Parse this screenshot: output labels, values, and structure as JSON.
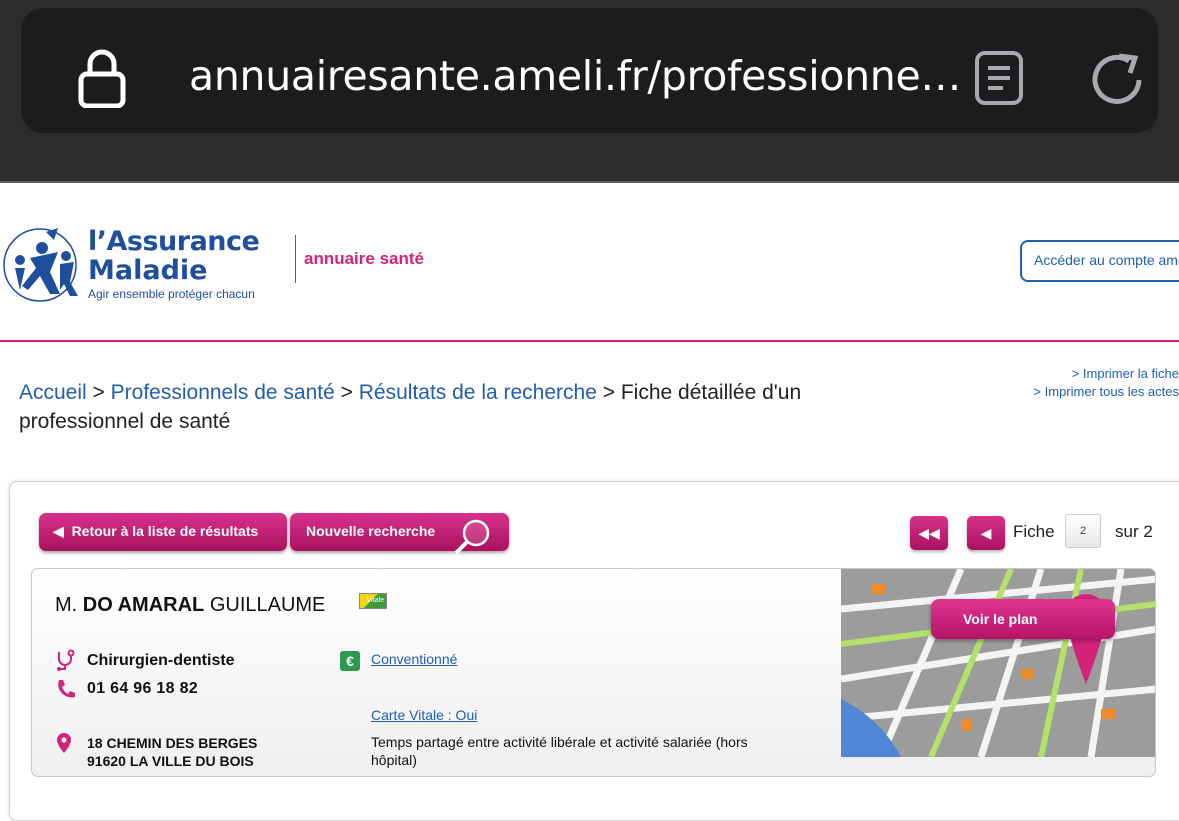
{
  "browser": {
    "url": "annuairesante.ameli.fr/professionne…"
  },
  "header": {
    "brand_line1": "l’Assurance",
    "brand_line2": "Maladie",
    "tagline": "Agir ensemble  protéger chacun",
    "section": "annuaire santé",
    "account_button": "Accéder au compte ameli"
  },
  "print": {
    "fiche": "> Imprimer la fiche",
    "actes": "> Imprimer tous les actes"
  },
  "breadcrumb": {
    "home": "Accueil",
    "pros": "Professionnels de santé",
    "results": "Résultats de la recherche",
    "current": "Fiche détaillée d'un professionnel de santé",
    "sep": ">"
  },
  "nav": {
    "back_button": "Retour à la liste de résultats",
    "new_search_button": "Nouvelle recherche",
    "fiche_label": "Fiche",
    "page": "2",
    "total_label": "sur 2"
  },
  "professional": {
    "civility": "M.",
    "last_name": "DO AMARAL",
    "first_name": "GUILLAUME",
    "specialty": "Chirurgien-dentiste",
    "phone": "01 64 96 18 82",
    "address_line1": "18 CHEMIN DES BERGES",
    "address_line2": "91620 LA VILLE DU BOIS",
    "convention": "Conventionné",
    "carte_vitale": "Carte Vitale : Oui",
    "activity": "Temps partagé entre activité libérale et activité salariée (hors hôpital)",
    "vitale_badge": "Vitale"
  },
  "map": {
    "button": "Voir le plan"
  },
  "colors": {
    "accent": "#d4237a",
    "link": "#1f5fae",
    "brand": "#1f4e9d"
  }
}
